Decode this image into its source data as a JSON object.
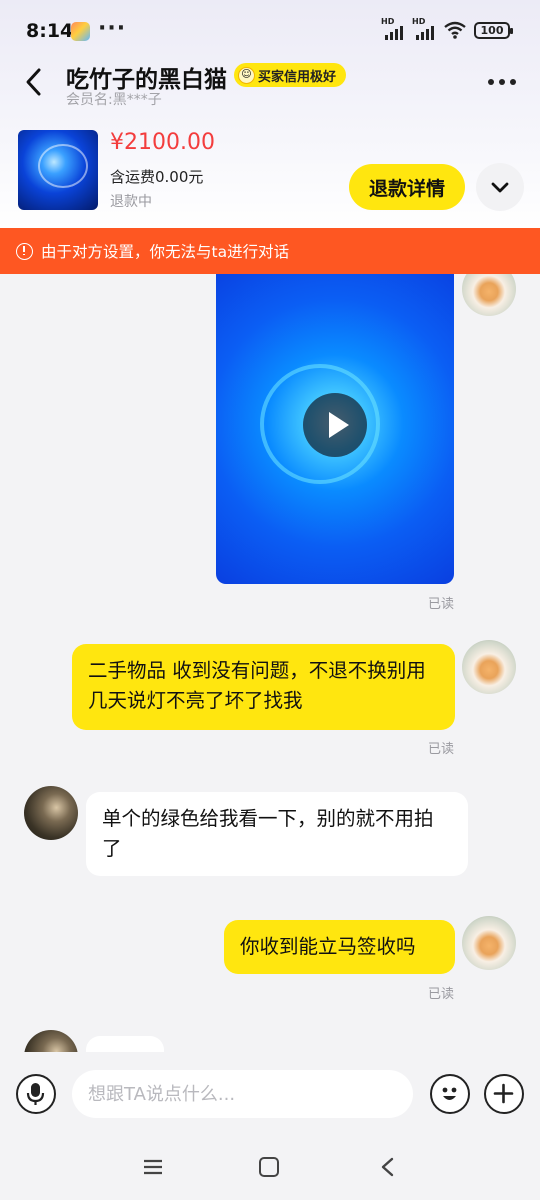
{
  "status_bar": {
    "time": "8:14",
    "more": "···",
    "battery": "100",
    "sim1_label": "HD",
    "sim2_label": "HD"
  },
  "header": {
    "shop_name": "吃竹子的黑白猫",
    "credit_badge": "买家信用极好",
    "member_label": "会员名:",
    "member_value": "黑***子"
  },
  "product": {
    "price": "¥2100.00",
    "shipping": "含运费0.00元",
    "status": "退款中",
    "refund_button": "退款详情"
  },
  "notice": {
    "text": "由于对方设置，你无法与ta进行对话",
    "color": "#fe5722"
  },
  "messages": [
    {
      "side": "mine",
      "type": "video",
      "read": "已读"
    },
    {
      "side": "mine",
      "type": "text",
      "text": "二手物品  收到没有问题，不退不换别用几天说灯不亮了坏了找我",
      "read": "已读"
    },
    {
      "side": "theirs",
      "type": "text",
      "text": "单个的绿色给我看一下，别的就不用拍了"
    },
    {
      "side": "mine",
      "type": "text",
      "text": "你收到能立马签收吗",
      "read": "已读"
    },
    {
      "side": "theirs",
      "type": "text",
      "text": ""
    }
  ],
  "input": {
    "placeholder": "想跟TA说点什么..."
  },
  "colors": {
    "accent_yellow": "#ffe60f",
    "price_red": "#f33d3d"
  }
}
